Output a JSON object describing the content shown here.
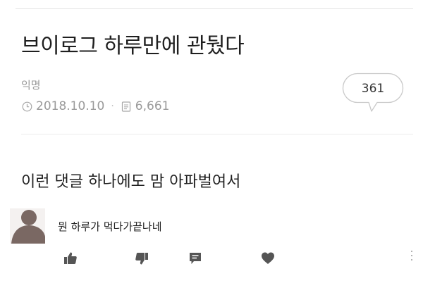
{
  "post": {
    "title": "브이로그 하루만에 관뒀다",
    "author": "익명",
    "date": "2018.10.10",
    "views": "6,661",
    "comment_count": "361",
    "icons": {
      "date": "clock-icon",
      "views": "document-icon",
      "comments": "speech-bubble-icon"
    }
  },
  "content": {
    "text": "이런 댓글 하나에도 맘 아파벌여서"
  },
  "comment": {
    "text": "뭔 하루가 먹다가끝나네",
    "icons": {
      "avatar": "avatar",
      "actions": [
        "thumbs-up-icon",
        "thumbs-down-icon",
        "reply-icon",
        "heart-icon"
      ],
      "more": "more-vertical-icon"
    }
  },
  "colors": {
    "text": "#222222",
    "muted": "#9a9a9a",
    "icon": "#555555",
    "divider": "#e3e3e3",
    "avatar": "#7a6863"
  }
}
